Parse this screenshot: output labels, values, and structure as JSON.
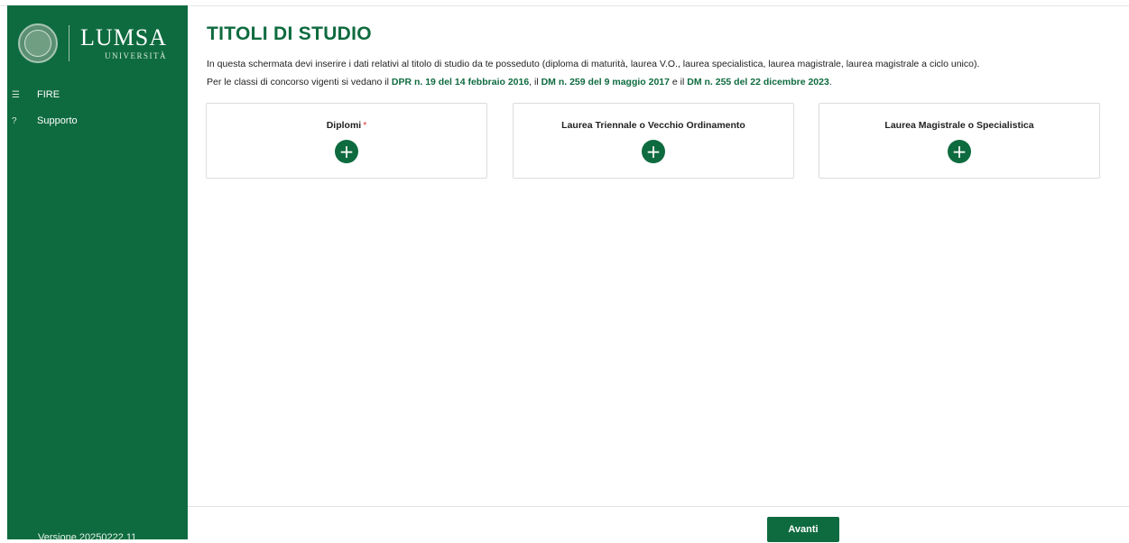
{
  "sidebar": {
    "logo": {
      "main": "LUMSA",
      "sub": "UNIVERSITÀ"
    },
    "items": [
      {
        "icon": "list-icon",
        "label": "FIRE"
      },
      {
        "icon": "question-icon",
        "label": "Supporto"
      }
    ],
    "version": "Versione 20250222.11"
  },
  "main": {
    "title": "TITOLI DI STUDIO",
    "description": "In questa schermata devi inserire i dati relativi al titolo di studio da te posseduto (diploma di maturità, laurea V.O., laurea specialistica, laurea magistrale, laurea magistrale a ciclo unico).",
    "classes_prefix": "Per le classi di concorso vigenti si vedano il ",
    "link1": "DPR n. 19 del 14 febbraio 2016",
    "sep1": ", il ",
    "link2": "DM n. 259 del 9 maggio 2017",
    "sep2": " e il ",
    "link3": "DM n. 255 del 22 dicembre 2023",
    "end": ".",
    "cards": [
      {
        "title": "Diplomi",
        "required": "*",
        "add_icon": "plus-icon"
      },
      {
        "title": "Laurea Triennale o Vecchio Ordinamento",
        "add_icon": "plus-icon"
      },
      {
        "title": "Laurea Magistrale o Specialistica",
        "add_icon": "plus-icon"
      }
    ],
    "next_button": "Avanti"
  },
  "colors": {
    "brand_green": "#0e6b3f",
    "required_red": "#dd3333"
  }
}
